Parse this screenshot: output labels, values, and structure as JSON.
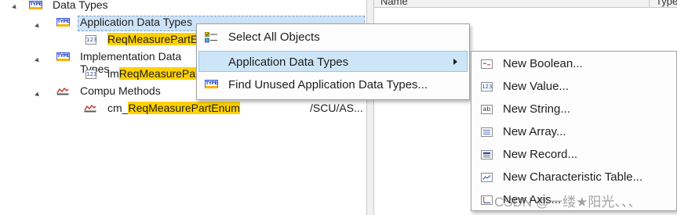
{
  "tree": {
    "root_label": "Data Types",
    "app_data_types_label": "Application Data Types",
    "app_item_label": "ReqMeasurePartEnum",
    "impl_data_types_label": "Implementation Data Types",
    "impl_item_prefix": "im",
    "impl_item_highlight": "ReqMeasurePartEnum",
    "compu_methods_label": "Compu Methods",
    "compu_item_prefix": "cm_",
    "compu_item_highlight": "ReqMeasurePartEnum",
    "compu_item_path": "/SCU/AS..."
  },
  "right_panel": {
    "columns": [
      "Name",
      "Type"
    ]
  },
  "context_menu": {
    "items": [
      {
        "label": "Select All Objects",
        "icon": "select-all-icon"
      },
      {
        "label": "Application Data Types",
        "icon": "",
        "has_submenu": true,
        "hovered": true
      },
      {
        "label": "Find Unused Application Data Types...",
        "icon": "type-icon"
      }
    ]
  },
  "submenu": {
    "items": [
      {
        "label": "New Boolean...",
        "icon": "boolean-icon"
      },
      {
        "label": "New Value...",
        "icon": "value-icon"
      },
      {
        "label": "New String...",
        "icon": "string-icon"
      },
      {
        "label": "New Array...",
        "icon": "array-icon"
      },
      {
        "label": "New Record...",
        "icon": "record-icon"
      },
      {
        "label": "New Characteristic Table...",
        "icon": "characteristic-table-icon"
      },
      {
        "label": "New Axis...",
        "icon": "axis-icon"
      }
    ]
  },
  "watermark": "CSDN @一缕★阳光、、、",
  "colors": {
    "highlight": "#ffd100",
    "hover": "#cde6f7",
    "type_icon_blue": "#3b5bdb"
  }
}
